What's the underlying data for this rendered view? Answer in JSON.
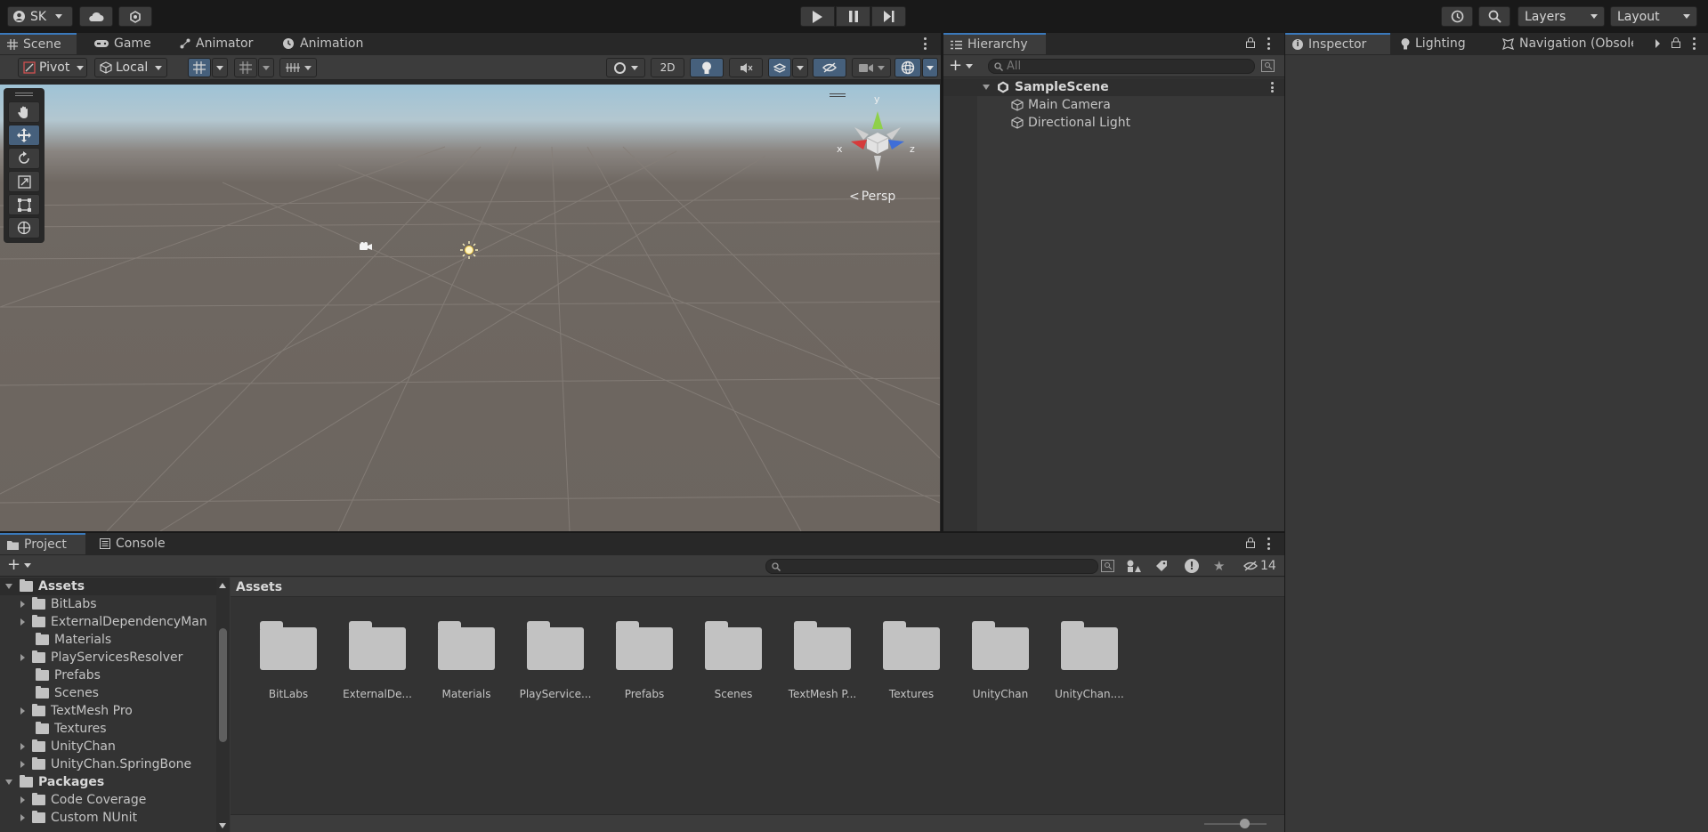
{
  "account": {
    "initials": "SK"
  },
  "toolbar": {
    "layers": "Layers",
    "layout": "Layout"
  },
  "scene_tabs": [
    {
      "label": "Scene",
      "icon": "grid-icon"
    },
    {
      "label": "Game",
      "icon": "gamepad-icon"
    },
    {
      "label": "Animator",
      "icon": "animator-icon"
    },
    {
      "label": "Animation",
      "icon": "clock-icon"
    }
  ],
  "scene_toolbar": {
    "pivot": "Pivot",
    "local": "Local",
    "mode_2d": "2D"
  },
  "viewport": {
    "axis_x": "x",
    "axis_y": "y",
    "axis_z": "z",
    "projection": "Persp"
  },
  "hierarchy": {
    "title": "Hierarchy",
    "search_placeholder": "All",
    "scene_name": "SampleScene",
    "objects": [
      "Main Camera",
      "Directional Light"
    ]
  },
  "inspector_tabs": [
    {
      "label": "Inspector"
    },
    {
      "label": "Lighting"
    },
    {
      "label": "Navigation (Obsolete"
    }
  ],
  "bottom_tabs": [
    {
      "label": "Project"
    },
    {
      "label": "Console"
    }
  ],
  "project": {
    "hidden_count": "14",
    "breadcrumb": "Assets",
    "tree": [
      {
        "label": "Assets",
        "level": 0,
        "expanded": true,
        "bold": true
      },
      {
        "label": "BitLabs",
        "level": 1,
        "expandable": true
      },
      {
        "label": "ExternalDependencyMan",
        "level": 1,
        "expandable": true
      },
      {
        "label": "Materials",
        "level": 1,
        "expandable": false
      },
      {
        "label": "PlayServicesResolver",
        "level": 1,
        "expandable": true
      },
      {
        "label": "Prefabs",
        "level": 1,
        "expandable": false
      },
      {
        "label": "Scenes",
        "level": 1,
        "expandable": false
      },
      {
        "label": "TextMesh Pro",
        "level": 1,
        "expandable": true
      },
      {
        "label": "Textures",
        "level": 1,
        "expandable": false
      },
      {
        "label": "UnityChan",
        "level": 1,
        "expandable": true
      },
      {
        "label": "UnityChan.SpringBone",
        "level": 1,
        "expandable": true
      },
      {
        "label": "Packages",
        "level": 0,
        "expanded": true,
        "bold": true
      },
      {
        "label": "Code Coverage",
        "level": 1,
        "expandable": true
      },
      {
        "label": "Custom NUnit",
        "level": 1,
        "expandable": true
      }
    ],
    "assets": [
      "BitLabs",
      "ExternalDe...",
      "Materials",
      "PlayService...",
      "Prefabs",
      "Scenes",
      "TextMesh P...",
      "Textures",
      "UnityChan",
      "UnityChan...."
    ]
  },
  "colors": {
    "accent": "#3a79bb",
    "active_tool": "#46607c",
    "panel": "#383838",
    "scene_ground": "#6f6862"
  }
}
